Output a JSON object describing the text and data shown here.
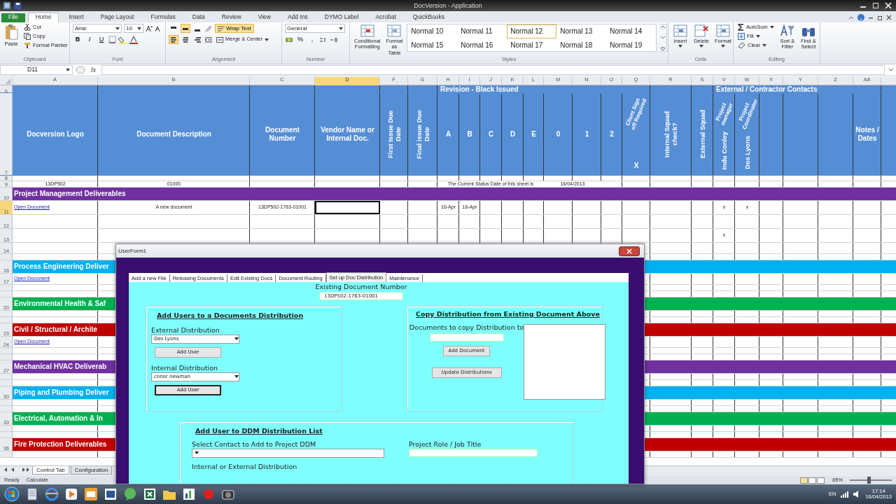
{
  "window": {
    "title": "DocVersion - Application"
  },
  "ribbon_tabs": [
    {
      "label": "File",
      "kind": "file",
      "selected": false
    },
    {
      "label": "Home",
      "kind": "tab",
      "selected": true
    },
    {
      "label": "Insert",
      "kind": "tab",
      "selected": false
    },
    {
      "label": "Page Layout",
      "kind": "tab",
      "selected": false
    },
    {
      "label": "Formulas",
      "kind": "tab",
      "selected": false
    },
    {
      "label": "Data",
      "kind": "tab",
      "selected": false
    },
    {
      "label": "Review",
      "kind": "tab",
      "selected": false
    },
    {
      "label": "View",
      "kind": "tab",
      "selected": false
    },
    {
      "label": "Add Ins",
      "kind": "tab",
      "selected": false
    },
    {
      "label": "DYMO Label",
      "kind": "tab",
      "selected": false
    },
    {
      "label": "Acrobat",
      "kind": "tab",
      "selected": false
    },
    {
      "label": "QuickBooks",
      "kind": "tab",
      "selected": false
    }
  ],
  "ribbon_groups": [
    {
      "kind": "clipboard",
      "title": "Clipboard",
      "big": "Paste",
      "items": [
        "Cut",
        "Copy",
        "Format Painter"
      ]
    },
    {
      "kind": "font",
      "title": "Font",
      "font": "Arial",
      "size": "10",
      "styles": [
        "B",
        "I",
        "U"
      ]
    },
    {
      "kind": "alignment",
      "title": "Alignment",
      "vertical_align": [
        {
          "selected": false
        },
        {
          "selected": true
        },
        {
          "selected": false
        }
      ],
      "horizontal_align": [
        {
          "selected": true
        },
        {
          "selected": false
        },
        {
          "selected": false
        }
      ],
      "wrap": {
        "label": "Wrap Text",
        "on": true
      },
      "merge": "Merge & Center"
    },
    {
      "kind": "number",
      "title": "Number",
      "format": "General",
      "symbols": [
        "%",
        ","
      ]
    },
    {
      "kind": "styles",
      "title": "Styles",
      "big": [
        "Conditional Formatting",
        "Format as Table"
      ],
      "styles": [
        {
          "label": "Normal 10",
          "selected": false
        },
        {
          "label": "Normal 11",
          "selected": false
        },
        {
          "label": "Normal 12",
          "selected": true
        },
        {
          "label": "Normal 13",
          "selected": false
        },
        {
          "label": "Normal 14",
          "selected": false
        },
        {
          "label": "Normal 15",
          "selected": false
        },
        {
          "label": "Normal 16",
          "selected": false
        },
        {
          "label": "Normal 17",
          "selected": false
        },
        {
          "label": "Normal 18",
          "selected": false
        },
        {
          "label": "Normal 19",
          "selected": false
        }
      ]
    },
    {
      "kind": "cells",
      "title": "Cells",
      "big": [
        "Insert",
        "Delete",
        "Format"
      ]
    },
    {
      "kind": "editing",
      "title": "Editing",
      "items": [
        "AutoSum",
        "Fill",
        "Clear"
      ],
      "big": [
        "Sort & Filter",
        "Find & Select"
      ]
    }
  ],
  "formula_bar": {
    "name_box": "D11",
    "function_label": "fx"
  },
  "columns": [
    {
      "letter": "A",
      "selected": false
    },
    {
      "letter": "B",
      "selected": false
    },
    {
      "letter": "C",
      "selected": false
    },
    {
      "letter": "D",
      "selected": true
    },
    {
      "letter": "F",
      "selected": false
    },
    {
      "letter": "G",
      "selected": false
    },
    {
      "letter": "H",
      "selected": false
    },
    {
      "letter": "I",
      "selected": false
    },
    {
      "letter": "J",
      "selected": false
    },
    {
      "letter": "K",
      "selected": false
    },
    {
      "letter": "L",
      "selected": false
    },
    {
      "letter": "M",
      "selected": false
    },
    {
      "letter": "N",
      "selected": false
    },
    {
      "letter": "O",
      "selected": false
    },
    {
      "letter": "Q",
      "selected": false
    },
    {
      "letter": "R",
      "selected": false
    },
    {
      "letter": "S",
      "selected": false
    },
    {
      "letter": "V",
      "selected": false
    },
    {
      "letter": "W",
      "selected": false
    },
    {
      "letter": "X",
      "selected": false
    },
    {
      "letter": "Y",
      "selected": false
    },
    {
      "letter": "Z",
      "selected": false
    },
    {
      "letter": "AA",
      "selected": false
    }
  ],
  "rows": [
    {
      "num": "6",
      "kind": "group_header",
      "selected": false,
      "cells": {
        "H:O": {
          "text": "Revision  - Black Issued"
        },
        "V:Z": {
          "text": "External / Contractor Contacts"
        }
      }
    },
    {
      "num": "7",
      "kind": "header",
      "selected": false,
      "cells": {
        "A": {
          "text": "Docversion Logo",
          "kind": "horizontal"
        },
        "B": {
          "text": "Document Description",
          "kind": "horizontal"
        },
        "C": {
          "text": "Document Number",
          "kind": "horizontal"
        },
        "D": {
          "text": "Vendor Name or Internal Doc.",
          "kind": "horizontal"
        },
        "F": {
          "text": "First Issue Due Date",
          "kind": "vertical"
        },
        "G": {
          "text": "Final issue Due Date",
          "kind": "vertical"
        },
        "H": {
          "text": "A",
          "kind": "horizontal"
        },
        "I": {
          "text": "B",
          "kind": "horizontal"
        },
        "J": {
          "text": "C",
          "kind": "horizontal"
        },
        "K": {
          "text": "D",
          "kind": "horizontal"
        },
        "L": {
          "text": "E",
          "kind": "horizontal"
        },
        "M": {
          "text": "0",
          "kind": "horizontal"
        },
        "N": {
          "text": "1",
          "kind": "horizontal"
        },
        "O": {
          "text": "2",
          "kind": "horizontal"
        },
        "Q": {
          "text": "X",
          "kind": "horizontal",
          "slant": "Client Sign off Required"
        },
        "R": {
          "text": "Internal Squad check?",
          "kind": "vertical"
        },
        "S": {
          "text": "External Squad",
          "kind": "vertical"
        },
        "V": {
          "text": "Indu Conley",
          "kind": "vertical",
          "slant": "Project manager"
        },
        "W": {
          "text": "Des Lyons",
          "kind": "vertical",
          "slant": "Project Coordinator"
        },
        "AA": {
          "text": "Notes / Dates",
          "kind": "horizontal"
        }
      }
    },
    {
      "num": "8",
      "kind": "tiny",
      "selected": false
    },
    {
      "num": "9",
      "kind": "summary",
      "selected": false,
      "cells": {
        "A": {
          "text": "13DP502"
        },
        "B": {
          "text": "01000"
        },
        "H:L": {
          "text": "The Current Status Date of this sheet is"
        },
        "M:N": {
          "text": "16/04/2013"
        }
      }
    },
    {
      "num": "10",
      "kind": "band",
      "selected": false,
      "color": "#7030a0",
      "text": "Project Management Deliverables"
    },
    {
      "num": "11",
      "kind": "data",
      "selected": true,
      "cells": {
        "A": {
          "text": "Open Document",
          "link": true
        },
        "B": {
          "text": "A new document"
        },
        "C": {
          "text": "13DP502-1763-01001"
        },
        "H": {
          "text": "16-Apr"
        },
        "I": {
          "text": "16-Apr"
        },
        "V": {
          "text": "x"
        },
        "W": {
          "text": "x"
        }
      }
    },
    {
      "num": "12",
      "kind": "data",
      "selected": false
    },
    {
      "num": "13",
      "kind": "data",
      "selected": false,
      "cells": {
        "V": {
          "text": "x"
        }
      }
    },
    {
      "num": "14",
      "kind": "low",
      "selected": false
    },
    {
      "kind": "gap"
    },
    {
      "num": "16",
      "kind": "band",
      "selected": false,
      "color": "#00b0f0",
      "text": "Process Engineering Deliver"
    },
    {
      "num": "17",
      "kind": "low",
      "selected": false,
      "cells": {
        "A": {
          "text": "Open Document",
          "link": true
        }
      }
    },
    {
      "kind": "gap"
    },
    {
      "kind": "gap"
    },
    {
      "num": "20",
      "kind": "band",
      "selected": false,
      "color": "#00b050",
      "text": "Environmental Health & Saf"
    },
    {
      "kind": "gap"
    },
    {
      "kind": "gap"
    },
    {
      "num": "23",
      "kind": "band",
      "selected": false,
      "color": "#c00000",
      "text": "Civil / Structural / Archite"
    },
    {
      "num": "24",
      "kind": "low",
      "selected": false,
      "cells": {
        "A": {
          "text": "Open Document",
          "link": true
        }
      }
    },
    {
      "kind": "gap"
    },
    {
      "kind": "gap"
    },
    {
      "num": "27",
      "kind": "band",
      "selected": false,
      "color": "#7030a0",
      "text": "Mechanical HVAC Deliverab"
    },
    {
      "kind": "gap"
    },
    {
      "kind": "gap"
    },
    {
      "num": "30",
      "kind": "band",
      "selected": false,
      "color": "#00b0f0",
      "text": "Piping and Plumbing Deliver"
    },
    {
      "kind": "gap"
    },
    {
      "kind": "gap"
    },
    {
      "num": "33",
      "kind": "band",
      "selected": false,
      "color": "#00b050",
      "text": "Electrical, Automation & In"
    },
    {
      "kind": "gap"
    },
    {
      "kind": "gap"
    },
    {
      "num": "36",
      "kind": "band",
      "selected": false,
      "color": "#c00000",
      "text": "Fire Protection Deliverables"
    },
    {
      "kind": "gap"
    }
  ],
  "sheet_tabs": [
    {
      "label": "Control Tab",
      "selected": true
    },
    {
      "label": "Configuration",
      "selected": false
    }
  ],
  "status_bar": {
    "items": [
      "Ready",
      "Calculate"
    ],
    "zoom": "85%",
    "zoom_slider": {
      "level": 0.45
    }
  },
  "dialog": {
    "title": "UserForm1",
    "tabs": [
      {
        "label": "Add a new File",
        "selected": false
      },
      {
        "label": "Releasing Documents",
        "selected": false
      },
      {
        "label": "Edit Existing Docs",
        "selected": false
      },
      {
        "label": "Document Routing",
        "selected": false
      },
      {
        "label": "Set up Doc Distribution",
        "selected": true
      },
      {
        "label": "Maintenance",
        "selected": false
      }
    ],
    "doc_number": {
      "label": "Existing Document Number",
      "value": "13DP502-1763-01001"
    },
    "left_frame": {
      "title": "Add Users to a Documents Distribution",
      "groups": [
        {
          "label": "External Distribution",
          "value": "Des Lyons",
          "button": "Add User",
          "focused": false
        },
        {
          "label": "Internal Distribution",
          "value": "conor newman",
          "button": "Add User",
          "focused": true
        }
      ]
    },
    "right_frame": {
      "title": "Copy Distribution from Existing Document Above",
      "label": "Documents to copy Distribution to",
      "buttons": [
        "Add Document",
        "Update Distributions"
      ]
    },
    "bottom_frame": {
      "title": "Add User to DDM Distribution List",
      "contact_label": "Select Contact to Add to Project DDM",
      "role_label": "Project Role / Job Title",
      "distribution_label": "Internal or External Distribution"
    }
  },
  "taskbar": {
    "language": "EN",
    "time": "17:14",
    "date": "16/04/2013"
  }
}
